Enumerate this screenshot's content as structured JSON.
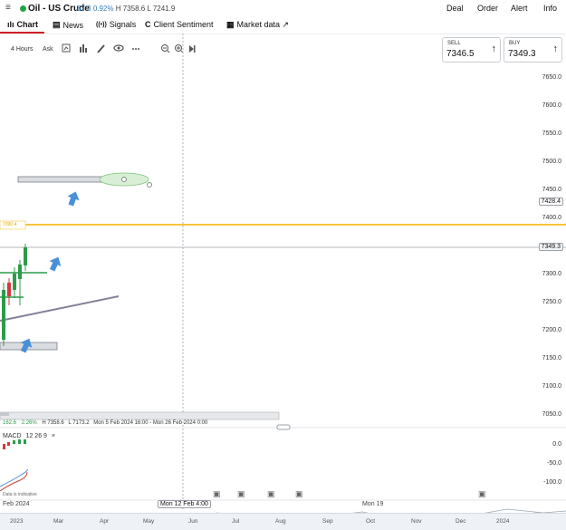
{
  "header": {
    "menu_icon": "≡",
    "instrument": "Oil - US Crude",
    "change": "67.3",
    "change_pct": "0.92%",
    "high": "H 7358.6",
    "low": "L 7241.9",
    "nav": [
      "Deal",
      "Order",
      "Alert",
      "Info"
    ]
  },
  "tabs": [
    {
      "icon": "ılı",
      "label": "Chart"
    },
    {
      "icon": "▤",
      "label": "News"
    },
    {
      "icon": "((•))",
      "label": "Signals"
    },
    {
      "icon": "C",
      "label": "Client Sentiment"
    },
    {
      "icon": "▦",
      "label": "Market data ↗"
    }
  ],
  "toolbar": {
    "timeframe": "4 Hours",
    "price_type": "Ask"
  },
  "sell": {
    "label": "SELL",
    "value": "7346.5"
  },
  "buy": {
    "label": "BUY",
    "value": "7349.3"
  },
  "y_axis": [
    "7650.0",
    "7600.0",
    "7550.0",
    "7500.0",
    "7450.0",
    "7400.0",
    "7300.0",
    "7250.0",
    "7200.0",
    "7150.0",
    "7100.0",
    "7050.0"
  ],
  "price_tags": {
    "top": "7428.4",
    "current": "7349.3",
    "alert": "7390.4"
  },
  "macd": {
    "label": "MACD",
    "params": "12  26  9",
    "close": "×",
    "axis": [
      "0.0",
      "-50.0",
      "-100.0"
    ]
  },
  "bottom_info": {
    "left": "162.6",
    "pct": "2.26%",
    "h": "H 7358.6",
    "l": "L 7173.2",
    "range": "Mon 5 Feb 2024 16:00 - Mon 26 Feb 2024 0:00"
  },
  "data_indicator": "Data is indicative",
  "x_axis": {
    "left": "Feb 2024",
    "hover": "Mon 12 Feb 4:00",
    "mid": "Mon 19"
  },
  "navigator": [
    "2023",
    "Mar",
    "Apr",
    "May",
    "Jun",
    "Jul",
    "Aug",
    "Sep",
    "Oct",
    "Nov",
    "Dec",
    "2024"
  ],
  "colors": {
    "accent_red": "#d11f2a",
    "up_green": "#2c9b4a",
    "down_red": "#d13b3b",
    "alert_line": "#f5c542",
    "arrow_blue": "#4a90d9"
  }
}
